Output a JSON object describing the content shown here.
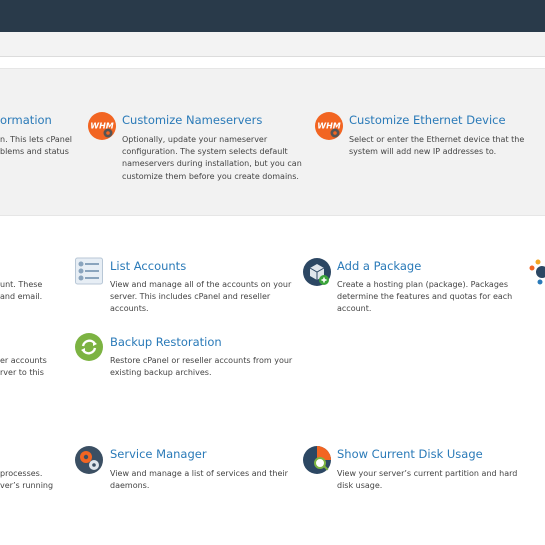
{
  "top_panel": {
    "left_fragment": {
      "title": "ormation",
      "lines": [
        "n. This lets cPanel",
        "blems and status"
      ]
    },
    "items": [
      {
        "title": "Customize Nameservers",
        "lines": [
          "Optionally, update your nameserver",
          "configuration. The system selects default",
          "nameservers during installation, but you can",
          "customize them before you create domains."
        ]
      },
      {
        "title": "Customize Ethernet Device",
        "lines": [
          "Select or enter the Ethernet device that the",
          "system will add new IP addresses to."
        ]
      }
    ]
  },
  "accounts_section": {
    "left_fragments": [
      [
        "unt. These",
        "and email."
      ],
      [
        "er accounts",
        "rver to this"
      ],
      [
        "processes.",
        "ver’s running"
      ]
    ],
    "items": [
      {
        "title": "List Accounts",
        "lines": [
          "View and manage all of the accounts on your",
          "server. This includes cPanel and reseller",
          "accounts."
        ]
      },
      {
        "title": "Add a Package",
        "lines": [
          "Create a hosting plan (package). Packages",
          "determine the features and quotas for each",
          "account."
        ]
      },
      {
        "title": "Backup Restoration",
        "lines": [
          "Restore cPanel or reseller accounts from your",
          "existing backup archives."
        ]
      },
      {
        "title": "Service Manager",
        "lines": [
          "View and manage a list of services and their",
          "daemons."
        ]
      },
      {
        "title": "Show Current Disk Usage",
        "lines": [
          "View your server’s current partition and hard",
          "disk usage."
        ]
      }
    ]
  },
  "colors": {
    "topbar": "#293a4a",
    "link": "#2a7ab8",
    "whm_orange": "#f26522"
  }
}
